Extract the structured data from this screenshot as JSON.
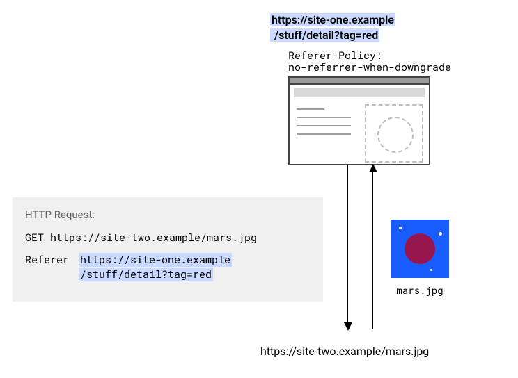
{
  "top_url": {
    "line1": "https://site-one.example",
    "line2": "/stuff/detail?tag=red"
  },
  "policy": {
    "line1": "Referer-Policy:",
    "line2": "no-referrer-when-downgrade"
  },
  "request": {
    "label": "HTTP Request:",
    "method_line": "GET https://site-two.example/mars.jpg",
    "referer_key": "Referer",
    "referer_val_line1": "https://site-one.example",
    "referer_val_line2": "/stuff/detail?tag=red"
  },
  "mars": {
    "caption": "mars.jpg"
  },
  "bottom_url": "https://site-two.example/mars.jpg"
}
